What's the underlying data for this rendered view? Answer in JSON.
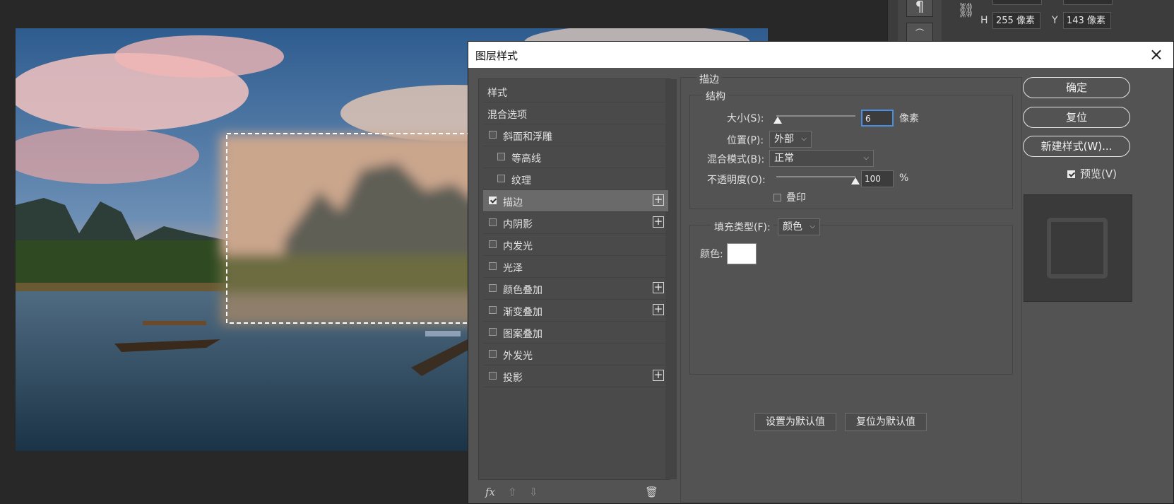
{
  "props": {
    "h_label": "H",
    "h_value": "255 像素",
    "y_label": "Y",
    "y_value": "143 像素",
    "paragraph_icon": "paragraph-icon",
    "link_icon": "link-icon"
  },
  "dialog": {
    "title": "图层样式",
    "close_label": "×"
  },
  "style_list": {
    "items": [
      {
        "label": "样式",
        "checkbox": false,
        "checked": false,
        "plus": false,
        "indent": false
      },
      {
        "label": "混合选项",
        "checkbox": false,
        "checked": false,
        "plus": false,
        "indent": false
      },
      {
        "label": "斜面和浮雕",
        "checkbox": true,
        "checked": false,
        "plus": false,
        "indent": false
      },
      {
        "label": "等高线",
        "checkbox": true,
        "checked": false,
        "plus": false,
        "indent": true
      },
      {
        "label": "纹理",
        "checkbox": true,
        "checked": false,
        "plus": false,
        "indent": true
      },
      {
        "label": "描边",
        "checkbox": true,
        "checked": true,
        "plus": true,
        "indent": false
      },
      {
        "label": "内阴影",
        "checkbox": true,
        "checked": false,
        "plus": true,
        "indent": false
      },
      {
        "label": "内发光",
        "checkbox": true,
        "checked": false,
        "plus": false,
        "indent": false
      },
      {
        "label": "光泽",
        "checkbox": true,
        "checked": false,
        "plus": false,
        "indent": false
      },
      {
        "label": "颜色叠加",
        "checkbox": true,
        "checked": false,
        "plus": true,
        "indent": false
      },
      {
        "label": "渐变叠加",
        "checkbox": true,
        "checked": false,
        "plus": true,
        "indent": false
      },
      {
        "label": "图案叠加",
        "checkbox": true,
        "checked": false,
        "plus": false,
        "indent": false
      },
      {
        "label": "外发光",
        "checkbox": true,
        "checked": false,
        "plus": false,
        "indent": false
      },
      {
        "label": "投影",
        "checkbox": true,
        "checked": false,
        "plus": true,
        "indent": false
      }
    ],
    "footer": {
      "fx_label": "fx",
      "up_icon": "arrow-up-icon",
      "down_icon": "arrow-down-icon",
      "trash_icon": "trash-icon"
    }
  },
  "stroke": {
    "section_title": "描边",
    "structure_title": "结构",
    "size_label": "大小(S):",
    "size_value": "6",
    "size_unit": "像素",
    "position_label": "位置(P):",
    "position_value": "外部",
    "blend_label": "混合模式(B):",
    "blend_value": "正常",
    "opacity_label": "不透明度(O):",
    "opacity_value": "100",
    "opacity_unit": "%",
    "overprint_label": "叠印",
    "overprint_checked": false,
    "fill_type_label": "填充类型(F):",
    "fill_type_value": "颜色",
    "color_label": "颜色:",
    "color_value": "#ffffff",
    "set_default_label": "设置为默认值",
    "reset_default_label": "复位为默认值"
  },
  "buttons": {
    "ok_label": "确定",
    "reset_label": "复位",
    "new_style_label": "新建样式(W)...",
    "preview_label": "预览(V)",
    "preview_checked": true
  },
  "colors": {
    "highlight": "#e3261d",
    "dialog_bg": "#535353",
    "focus": "#4a90e2"
  }
}
